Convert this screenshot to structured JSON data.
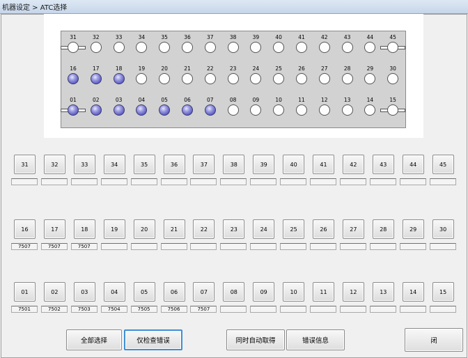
{
  "title": "机器设定 > ATC选择",
  "plate_rows": [
    {
      "slots": [
        {
          "n": "31",
          "state": "bar"
        },
        {
          "n": "32",
          "state": "empty"
        },
        {
          "n": "33",
          "state": "empty"
        },
        {
          "n": "34",
          "state": "empty"
        },
        {
          "n": "35",
          "state": "empty"
        },
        {
          "n": "36",
          "state": "empty"
        },
        {
          "n": "37",
          "state": "empty"
        },
        {
          "n": "38",
          "state": "empty"
        },
        {
          "n": "39",
          "state": "empty"
        },
        {
          "n": "40",
          "state": "empty"
        },
        {
          "n": "41",
          "state": "empty"
        },
        {
          "n": "42",
          "state": "empty"
        },
        {
          "n": "43",
          "state": "empty"
        },
        {
          "n": "44",
          "state": "empty"
        },
        {
          "n": "45",
          "state": "bar"
        }
      ]
    },
    {
      "slots": [
        {
          "n": "16",
          "state": "filled"
        },
        {
          "n": "17",
          "state": "filled"
        },
        {
          "n": "18",
          "state": "filled"
        },
        {
          "n": "19",
          "state": "empty"
        },
        {
          "n": "20",
          "state": "empty"
        },
        {
          "n": "21",
          "state": "empty"
        },
        {
          "n": "22",
          "state": "empty"
        },
        {
          "n": "23",
          "state": "empty"
        },
        {
          "n": "24",
          "state": "empty"
        },
        {
          "n": "25",
          "state": "empty"
        },
        {
          "n": "26",
          "state": "empty"
        },
        {
          "n": "27",
          "state": "empty"
        },
        {
          "n": "28",
          "state": "empty"
        },
        {
          "n": "29",
          "state": "empty"
        },
        {
          "n": "30",
          "state": "empty"
        }
      ]
    },
    {
      "slots": [
        {
          "n": "01",
          "state": "filled-bar"
        },
        {
          "n": "02",
          "state": "filled"
        },
        {
          "n": "03",
          "state": "filled"
        },
        {
          "n": "04",
          "state": "filled"
        },
        {
          "n": "05",
          "state": "filled"
        },
        {
          "n": "06",
          "state": "filled"
        },
        {
          "n": "07",
          "state": "filled"
        },
        {
          "n": "08",
          "state": "empty"
        },
        {
          "n": "09",
          "state": "empty"
        },
        {
          "n": "10",
          "state": "empty"
        },
        {
          "n": "11",
          "state": "empty"
        },
        {
          "n": "12",
          "state": "empty"
        },
        {
          "n": "13",
          "state": "empty"
        },
        {
          "n": "14",
          "state": "empty"
        },
        {
          "n": "15",
          "state": "bar"
        }
      ]
    }
  ],
  "button_rows": [
    {
      "buttons": [
        {
          "label": "31",
          "value": ""
        },
        {
          "label": "32",
          "value": ""
        },
        {
          "label": "33",
          "value": ""
        },
        {
          "label": "34",
          "value": ""
        },
        {
          "label": "35",
          "value": ""
        },
        {
          "label": "36",
          "value": ""
        },
        {
          "label": "37",
          "value": ""
        },
        {
          "label": "38",
          "value": ""
        },
        {
          "label": "39",
          "value": ""
        },
        {
          "label": "40",
          "value": ""
        },
        {
          "label": "41",
          "value": ""
        },
        {
          "label": "42",
          "value": ""
        },
        {
          "label": "43",
          "value": ""
        },
        {
          "label": "44",
          "value": ""
        },
        {
          "label": "45",
          "value": ""
        }
      ]
    },
    {
      "buttons": [
        {
          "label": "16",
          "value": "7507"
        },
        {
          "label": "17",
          "value": "7507"
        },
        {
          "label": "18",
          "value": "7507"
        },
        {
          "label": "19",
          "value": ""
        },
        {
          "label": "20",
          "value": ""
        },
        {
          "label": "21",
          "value": ""
        },
        {
          "label": "22",
          "value": ""
        },
        {
          "label": "23",
          "value": ""
        },
        {
          "label": "24",
          "value": ""
        },
        {
          "label": "25",
          "value": ""
        },
        {
          "label": "26",
          "value": ""
        },
        {
          "label": "27",
          "value": ""
        },
        {
          "label": "28",
          "value": ""
        },
        {
          "label": "29",
          "value": ""
        },
        {
          "label": "30",
          "value": ""
        }
      ]
    },
    {
      "buttons": [
        {
          "label": "01",
          "value": "7501"
        },
        {
          "label": "02",
          "value": "7502"
        },
        {
          "label": "03",
          "value": "7503"
        },
        {
          "label": "04",
          "value": "7504"
        },
        {
          "label": "05",
          "value": "7505"
        },
        {
          "label": "06",
          "value": "7506"
        },
        {
          "label": "07",
          "value": "7507"
        },
        {
          "label": "08",
          "value": ""
        },
        {
          "label": "09",
          "value": ""
        },
        {
          "label": "10",
          "value": ""
        },
        {
          "label": "11",
          "value": ""
        },
        {
          "label": "12",
          "value": ""
        },
        {
          "label": "13",
          "value": ""
        },
        {
          "label": "14",
          "value": ""
        },
        {
          "label": "15",
          "value": ""
        }
      ]
    }
  ],
  "actions": {
    "select_all": "全部选择",
    "check_errors_only": "仅检查错误",
    "auto_fetch": "同时自动取得",
    "error_info": "错误信息",
    "close": "闭"
  }
}
